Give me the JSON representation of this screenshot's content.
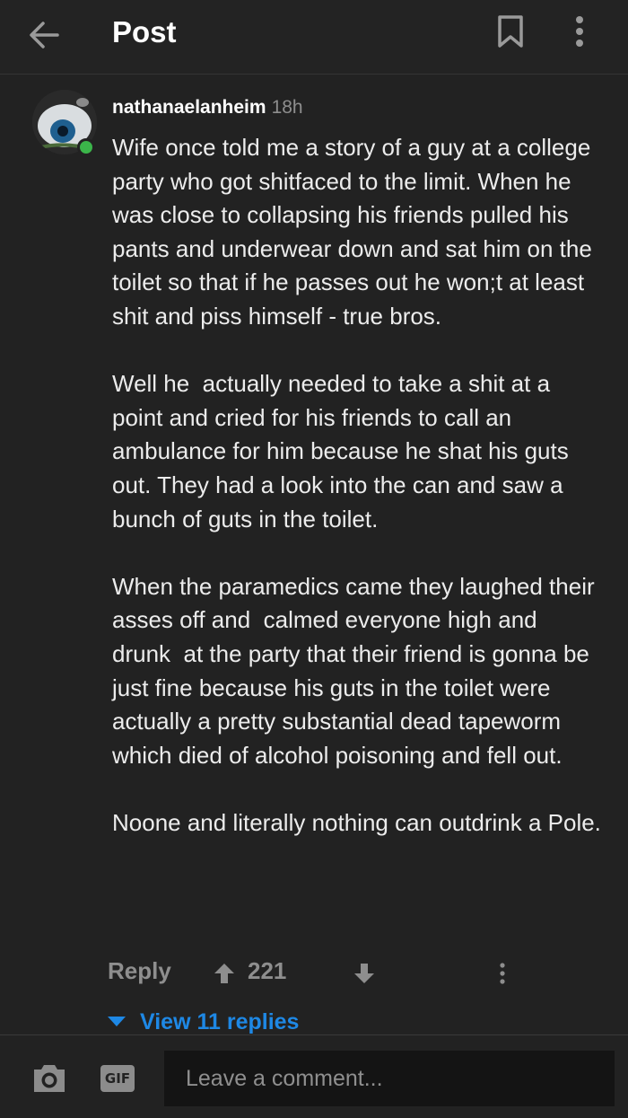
{
  "header": {
    "title": "Post"
  },
  "comment": {
    "author": "nathanaelanheim",
    "time": "18h",
    "paragraphs": [
      "Wife once told me a story of a guy at a college party who got shitfaced to the limit. When he was close to collapsing his friends pulled his pants and underwear down and sat him on the toilet so that if he passes out he won;t at least shit and piss himself - true bros.",
      "Well he  actually needed to take a shit at a point and cried for his friends to call an ambulance for him because he shat his guts out. They had a look into the can and saw a bunch of guts in the toilet.",
      "When the paramedics came they laughed their asses off and  calmed everyone high and drunk  at the party that their friend is gonna be just fine because his guts in the toilet were actually a pretty substantial dead tapeworm which died of alcohol poisoning and fell out.",
      "Noone and literally nothing can outdrink a Pole."
    ],
    "reply_label": "Reply",
    "upvotes": "221",
    "view_replies": "View 11 replies",
    "online_color": "#3bb54a"
  },
  "composer": {
    "gif_label": "GIF",
    "placeholder": "Leave a comment..."
  },
  "colors": {
    "accent": "#1e88e5",
    "background": "#222222"
  },
  "icons": [
    "back-arrow-icon",
    "bookmark-icon",
    "more-vertical-icon",
    "upvote-arrow-icon",
    "downvote-arrow-icon",
    "camera-icon",
    "gif-icon"
  ]
}
